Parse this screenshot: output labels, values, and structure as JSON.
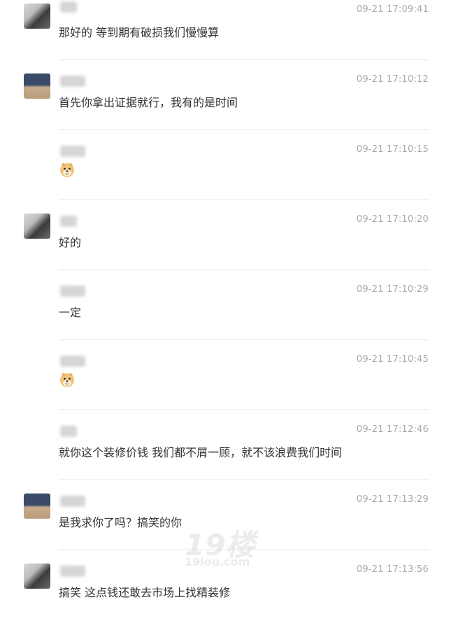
{
  "messages": [
    {
      "time": "09-21 17:09:41",
      "text": "那好的 等到期有破损我们慢慢算",
      "avatar": "dark-room",
      "name_blurred": true,
      "emoji": null
    },
    {
      "time": "09-21 17:10:12",
      "text": "首先你拿出证据就行，我有的是时间",
      "avatar": "blue-brown",
      "name_blurred": true,
      "emoji": null
    },
    {
      "time": "09-21 17:10:15",
      "text": "",
      "avatar": "none",
      "name_blurred": true,
      "emoji": "doge-face-icon"
    },
    {
      "time": "09-21 17:10:20",
      "text": "好的",
      "avatar": "dark-room",
      "name_blurred": true,
      "emoji": null
    },
    {
      "time": "09-21 17:10:29",
      "text": "一定",
      "avatar": "none",
      "name_blurred": true,
      "emoji": null
    },
    {
      "time": "09-21 17:10:45",
      "text": "",
      "avatar": "none",
      "name_blurred": true,
      "emoji": "doge-face-icon"
    },
    {
      "time": "09-21 17:12:46",
      "text": "就你这个装修价钱 我们都不屑一顾，就不该浪费我们时间",
      "avatar": "none",
      "name_blurred": true,
      "emoji": null
    },
    {
      "time": "09-21 17:13:29",
      "text": "是我求你了吗？搞笑的你",
      "avatar": "blue-brown",
      "name_blurred": true,
      "emoji": null
    },
    {
      "time": "09-21 17:13:56",
      "text": "搞笑 这点钱还敢去市场上找精装修",
      "avatar": "dark-room",
      "name_blurred": true,
      "emoji": null
    }
  ],
  "watermark": {
    "big": "19楼",
    "small": "19lou.com"
  },
  "colors": {
    "text": "#333333",
    "time": "#a8a8a8",
    "separator": "#e6e6e6"
  }
}
